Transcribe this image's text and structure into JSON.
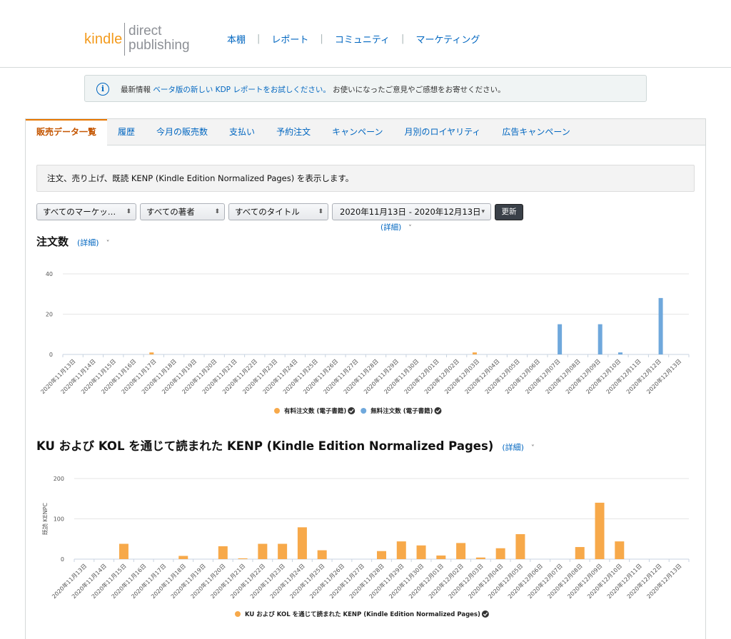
{
  "logo": {
    "kindle": "kindle",
    "direct": "direct",
    "publishing": "publishing"
  },
  "topnav": {
    "items": [
      "本棚",
      "レポート",
      "コミュニティ",
      "マーケティング"
    ],
    "separator": "|"
  },
  "notice": {
    "prefix": "最新情報",
    "link": "ベータ版の新しい KDP レポートをお試しください。",
    "suffix": "お使いになったご意見やご感想をお寄せください。",
    "icon": "info-icon"
  },
  "tabs": [
    "販売データ一覧",
    "履歴",
    "今月の販売数",
    "支払い",
    "予約注文",
    "キャンペーン",
    "月別のロイヤリティ",
    "広告キャンペーン"
  ],
  "info_text": "注文、売り上げ、既読 KENP (Kindle Edition Normalized Pages) を表示します。",
  "filters": {
    "marketplace": "すべてのマーケッ…",
    "author": "すべての著者",
    "title": "すべてのタイトル",
    "date_range": "2020年11月13日 - 2020年12月13日",
    "update": "更新",
    "detail": "(詳細)"
  },
  "section1": {
    "title": "注文数",
    "detail": "(詳細)"
  },
  "section2": {
    "title": "KU および KOL を通じて読まれた KENP (Kindle Edition Normalized Pages)",
    "detail": "(詳細)"
  },
  "colors": {
    "paid": "#f7a94a",
    "free": "#6fa8dc",
    "kenp": "#f7a94a",
    "accent": "#e77600",
    "link": "#0066c0"
  },
  "chart_data": [
    {
      "type": "bar",
      "title": "注文数",
      "categories": [
        "2020年11月13日",
        "2020年11月14日",
        "2020年11月15日",
        "2020年11月16日",
        "2020年11月17日",
        "2020年11月18日",
        "2020年11月19日",
        "2020年11月20日",
        "2020年11月21日",
        "2020年11月22日",
        "2020年11月23日",
        "2020年11月24日",
        "2020年11月25日",
        "2020年11月26日",
        "2020年11月27日",
        "2020年11月28日",
        "2020年11月29日",
        "2020年11月30日",
        "2020年12月01日",
        "2020年12月02日",
        "2020年12月03日",
        "2020年12月04日",
        "2020年12月05日",
        "2020年12月06日",
        "2020年12月07日",
        "2020年12月08日",
        "2020年12月09日",
        "2020年12月10日",
        "2020年12月11日",
        "2020年12月12日",
        "2020年12月13日"
      ],
      "series": [
        {
          "name": "有料注文数 (電子書籍)",
          "values": [
            0,
            0,
            0,
            0,
            1,
            0,
            0,
            0,
            0,
            0,
            0,
            0,
            0,
            0,
            0,
            0,
            0,
            0,
            0,
            0,
            1,
            0,
            0,
            0,
            0,
            0,
            0,
            0,
            0,
            0,
            0
          ]
        },
        {
          "name": "無料注文数 (電子書籍)",
          "values": [
            0,
            0,
            0,
            0,
            0,
            0,
            0,
            0,
            0,
            0,
            0,
            0,
            0,
            0,
            0,
            0,
            0,
            0,
            0,
            0,
            0,
            0,
            0,
            0,
            15,
            0,
            15,
            1,
            0,
            28,
            0
          ]
        }
      ],
      "yticks": [
        0,
        20,
        40
      ],
      "ylim": [
        0,
        40
      ],
      "grid": true,
      "legend": "bottom"
    },
    {
      "type": "bar",
      "title": "KU および KOL を通じて読まれた KENP (Kindle Edition Normalized Pages)",
      "ylabel": "既読 KENPC",
      "categories": [
        "2020年11月13日",
        "2020年11月14日",
        "2020年11月15日",
        "2020年11月16日",
        "2020年11月17日",
        "2020年11月18日",
        "2020年11月19日",
        "2020年11月20日",
        "2020年11月21日",
        "2020年11月22日",
        "2020年11月23日",
        "2020年11月24日",
        "2020年11月25日",
        "2020年11月26日",
        "2020年11月27日",
        "2020年11月28日",
        "2020年11月29日",
        "2020年11月30日",
        "2020年12月01日",
        "2020年12月02日",
        "2020年12月03日",
        "2020年12月04日",
        "2020年12月05日",
        "2020年12月06日",
        "2020年12月07日",
        "2020年12月08日",
        "2020年12月09日",
        "2020年12月10日",
        "2020年12月11日",
        "2020年12月12日",
        "2020年12月13日"
      ],
      "series": [
        {
          "name": "KU および KOL を通じて読まれた KENP (Kindle Edition Normalized Pages)",
          "values": [
            0,
            0,
            38,
            0,
            0,
            8,
            0,
            32,
            2,
            38,
            38,
            79,
            22,
            0,
            0,
            20,
            44,
            34,
            9,
            40,
            4,
            27,
            62,
            0,
            0,
            30,
            140,
            44,
            0,
            0,
            0
          ]
        }
      ],
      "yticks": [
        0,
        100,
        200
      ],
      "ylim": [
        0,
        200
      ],
      "grid": true,
      "legend": "bottom"
    }
  ]
}
